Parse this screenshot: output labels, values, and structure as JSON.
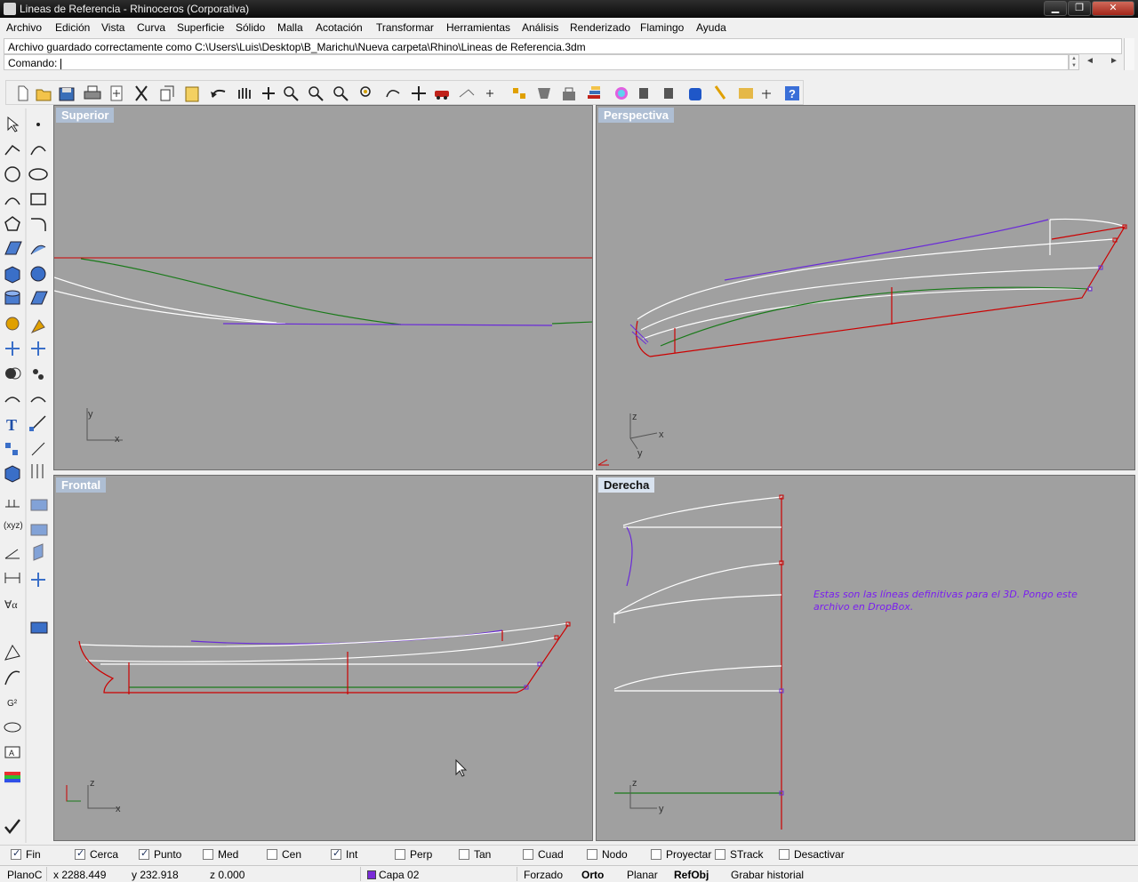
{
  "window": {
    "title": "Lineas de Referencia - Rhinoceros (Corporativa)",
    "min_glyph": "▁",
    "max_glyph": "❐",
    "close_glyph": "✕"
  },
  "menu": [
    "Archivo",
    "Edición",
    "Vista",
    "Curva",
    "Superficie",
    "Sólido",
    "Malla",
    "Acotación",
    "Transformar",
    "Herramientas",
    "Análisis",
    "Renderizado",
    "Flamingo",
    "Ayuda"
  ],
  "command": {
    "history": "Archivo guardado correctamente como C:\\Users\\Luis\\Desktop\\B_Marichu\\Nueva carpeta\\Rhino\\Lineas de Referencia.3dm",
    "prompt_label": "Comando:",
    "value": "",
    "arrow_left": "◄",
    "arrow_right": "►"
  },
  "toolbar_top": [
    "new-icon",
    "open-icon",
    "save-icon",
    "print-icon",
    "import-icon",
    "cut-icon",
    "copy-icon",
    "paste-icon",
    "undo-icon",
    "pan-icon",
    "rotate-view-icon",
    "zoom-dynamic-icon",
    "zoom-window-icon",
    "zoom-extents-icon",
    "zoom-selected-icon",
    "undo-view-icon",
    "grid-4view-icon",
    "set-cplane-icon",
    "car-icon",
    "drop-icon",
    "points-icon",
    "select-icon",
    "hide-icon",
    "lock-icon",
    "layers-icon",
    "material-icon",
    "render-icon",
    "render-preview-icon",
    "shaded-icon",
    "light-icon",
    "options-icon",
    "osnap-icon",
    "help-icon"
  ],
  "toolbar_left": [
    "select-arrow-icon",
    "point-icon",
    "polyline-icon",
    "curve-icon",
    "circle-icon",
    "ellipse-icon",
    "arc-icon",
    "rectangle-icon",
    "polygon-icon",
    "fillet-curve-icon",
    "surface-icon",
    "surface-edit-icon",
    "box-icon",
    "sphere-icon",
    "cylinder-icon",
    "planar-surface-icon",
    "mesh-icon",
    "explode-icon",
    "trim-icon",
    "split-icon",
    "boolean-icon",
    "group-icon",
    "fillet-icon",
    "offset-icon",
    "text-icon",
    "move-icon",
    "array-icon",
    "scale-icon",
    "block-icon",
    "dimension-icon",
    "grid-icon",
    "cplane-icon",
    "xyz-icon",
    "view-top-icon",
    "angle-icon",
    "view-perspective-icon",
    "length-icon",
    "view-4-icon",
    "radius-icon",
    "world-icon",
    "ruler-icon",
    "properties-icon",
    "analyze-icon",
    "zebra-icon",
    "curvature-icon",
    "layer-icon",
    "check-icon"
  ],
  "viewports": {
    "top": {
      "label": "Superior",
      "axis_x": "x",
      "axis_y": "y"
    },
    "perspective": {
      "label": "Perspectiva",
      "axis_x": "x",
      "axis_y": "y",
      "axis_z": "z"
    },
    "front": {
      "label": "Frontal",
      "axis_x": "x",
      "axis_z": "z"
    },
    "right": {
      "label": "Derecha",
      "axis_y": "y",
      "axis_z": "z",
      "note": "Estas son las líneas definitivas para el 3D. Pongo este archivo en DropBox."
    }
  },
  "osnaps": [
    {
      "label": "Fin",
      "checked": true
    },
    {
      "label": "Cerca",
      "checked": true
    },
    {
      "label": "Punto",
      "checked": true
    },
    {
      "label": "Med",
      "checked": false
    },
    {
      "label": "Cen",
      "checked": false
    },
    {
      "label": "Int",
      "checked": true
    },
    {
      "label": "Perp",
      "checked": false
    },
    {
      "label": "Tan",
      "checked": false
    },
    {
      "label": "Cuad",
      "checked": false
    },
    {
      "label": "Nodo",
      "checked": false
    },
    {
      "label": "Proyectar",
      "checked": false
    },
    {
      "label": "STrack",
      "checked": false
    },
    {
      "label": "Desactivar",
      "checked": false
    }
  ],
  "status": {
    "cplane": "PlanoC",
    "x": "x 2288.449",
    "y": "y 232.918",
    "z": "z 0.000",
    "layer": "Capa 02",
    "layer_color": "#7a2bd8",
    "grid_snap": "Forzado",
    "ortho": "Orto",
    "planar": "Planar",
    "osnap": "RefObj",
    "history": "Grabar historial"
  },
  "colors": {
    "viewport_bg": "#a0a0a0",
    "curve_red": "#cc0000",
    "curve_green": "#1a7a1a",
    "curve_purple": "#6a2bd8",
    "curve_white": "#ffffff",
    "note_purple": "#7a1ef0"
  }
}
